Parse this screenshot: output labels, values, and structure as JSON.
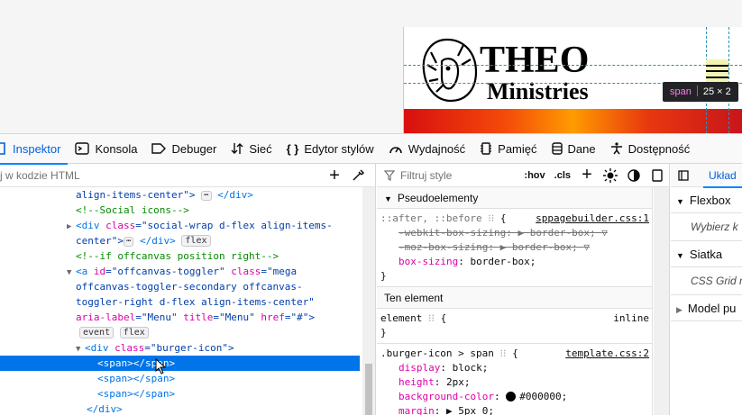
{
  "page": {
    "logo_text_1": "THEO",
    "logo_text_2": "Ministries",
    "tooltip": {
      "tag": "span",
      "size": "25 × 2"
    }
  },
  "toolbar": {
    "tabs": [
      {
        "label": "Inspektor",
        "icon": "inspector-icon",
        "active": true
      },
      {
        "label": "Konsola",
        "icon": "console-icon"
      },
      {
        "label": "Debuger",
        "icon": "debugger-icon"
      },
      {
        "label": "Sieć",
        "icon": "network-icon"
      },
      {
        "label": "Edytor stylów",
        "icon": "style-editor-icon"
      },
      {
        "label": "Wydajność",
        "icon": "performance-icon"
      },
      {
        "label": "Pamięć",
        "icon": "memory-icon"
      },
      {
        "label": "Dane",
        "icon": "storage-icon"
      },
      {
        "label": "Dostępność",
        "icon": "accessibility-icon"
      }
    ]
  },
  "markup": {
    "search_placeholder": "j w kodzie HTML",
    "lines": {
      "l1a": "align-items-center\">",
      "l1b": "</div>",
      "l2": "<!--Social icons-->",
      "l3a": "<div ",
      "l3b": "class",
      "l3c": "=\"social-wrap d-flex align-items-",
      "l4a": "center\">",
      "l4b": "</div>",
      "l4badge": "flex",
      "l5": "<!--if offcanvas position right-->",
      "l6a": "<a ",
      "l6b": "id",
      "l6c": "=\"offcanvas-toggler\" ",
      "l6d": "class",
      "l6e": "=\"mega",
      "l7": "offcanvas-toggler-secondary offcanvas-",
      "l8": "toggler-right d-flex align-items-center\"",
      "l9a": "aria-label",
      "l9b": "=\"Menu\" ",
      "l9c": "title",
      "l9d": "=\"Menu\" ",
      "l9e": "href",
      "l9f": "=\"#\">",
      "l10a": "event",
      "l10b": "flex",
      "l11a": "<div ",
      "l11b": "class",
      "l11c": "=\"burger-icon\">",
      "l12": "<span></span>",
      "l13": "<span></span>",
      "l14": "<span></span>",
      "l15": "</div>"
    }
  },
  "rules": {
    "filter_placeholder": "Filtruj style",
    "hov": ":hov",
    "cls": ".cls",
    "pseudo_header": "Pseudoelementy",
    "pseudo_selector": "::after, ::before",
    "pseudo_src": "sppagebuilder.css:1",
    "pseudo_props": [
      {
        "name": "-webkit-box-sizing",
        "value": "border-box;",
        "struck": true
      },
      {
        "name": "-moz-box-sizing",
        "value": "border-box;",
        "struck": true
      },
      {
        "name": "box-sizing",
        "value": "border-box;",
        "struck": false
      }
    ],
    "element_header": "Ten element",
    "element_selector": "element",
    "element_src": "inline",
    "burger_selector": ".burger-icon > span",
    "burger_src": "template.css:2",
    "burger_props": [
      {
        "name": "display",
        "value": "block;"
      },
      {
        "name": "height",
        "value": "2px;"
      },
      {
        "name": "background-color",
        "value": "#000000;",
        "swatch": "#000000"
      },
      {
        "name": "margin",
        "value": "5px 0;"
      }
    ]
  },
  "layout": {
    "tab": "Układ",
    "sections": [
      {
        "title": "Flexbox",
        "body": "Wybierz k"
      },
      {
        "title": "Siatka",
        "body": "CSS Grid n"
      },
      {
        "title": "Model pu"
      }
    ]
  }
}
